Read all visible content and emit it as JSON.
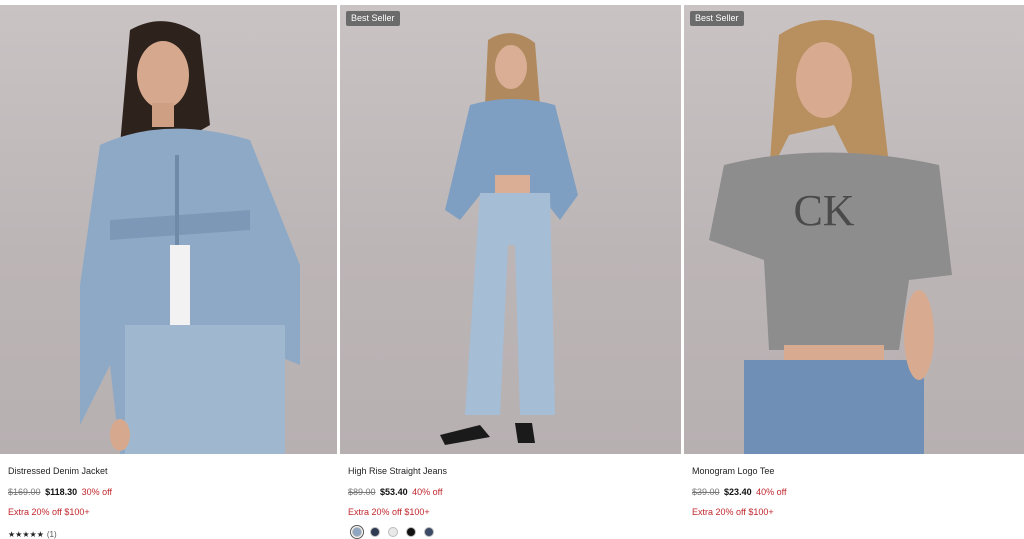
{
  "products": [
    {
      "name": "Distressed Denim Jacket",
      "original_price": "$169.00",
      "sale_price": "$118.30",
      "discount": "30% off",
      "promo": "Extra 20% off $100+",
      "stars": "★★★★★",
      "review_count": "(1)"
    },
    {
      "badge": "Best Seller",
      "name": "High Rise Straight Jeans",
      "original_price": "$89.00",
      "sale_price": "$53.40",
      "discount": "40% off",
      "promo": "Extra 20% off $100+",
      "swatch_colors": [
        "#8ea6c2",
        "#2d3a4f",
        "#e9e9e9",
        "#111111",
        "#3b4a66"
      ]
    },
    {
      "badge": "Best Seller",
      "name": "Monogram Logo Tee",
      "original_price": "$39.00",
      "sale_price": "$23.40",
      "discount": "40% off",
      "promo": "Extra 20% off $100+",
      "logo_text": "Calvin Klein"
    }
  ],
  "colors": {
    "sale_red": "#c0272d",
    "badge_bg": "#6b6b6b"
  }
}
